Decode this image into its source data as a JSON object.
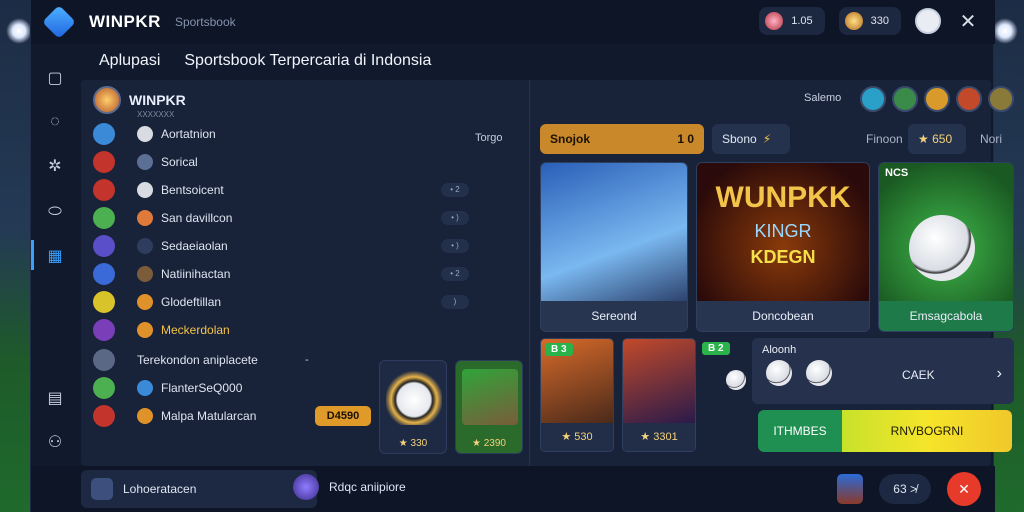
{
  "topbar": {
    "brand": "WINPKR",
    "section": "Sportsbook",
    "pill1_value": "1.05",
    "pill2_value": "330",
    "close_label": "✕"
  },
  "subbar": {
    "left": "Aplupasi",
    "right": "Sportsbook Terpercaria di Indonsia"
  },
  "club": {
    "name": "WINPKR",
    "tag": "XXXXXXX"
  },
  "list": {
    "header": "Torgo",
    "rows": [
      {
        "label": "Aortatnion",
        "dots": ""
      },
      {
        "label": "Sorical",
        "dots": ""
      },
      {
        "label": "Bentsoicent",
        "dots": "• 2"
      },
      {
        "label": "San davillcon",
        "dots": "• )"
      },
      {
        "label": "Sedaeiaolan",
        "dots": "• )"
      },
      {
        "label": "Natiinihactan",
        "dots": "• 2"
      },
      {
        "label": "Glodeftillan",
        "dots": ")"
      },
      {
        "label": "Meckerdolan",
        "dots": ""
      },
      {
        "label": "Terekondon aniplacete",
        "dots": "-"
      },
      {
        "label": "FlanterSeQ000",
        "dots": ""
      },
      {
        "label": "Malpa Matularcan",
        "dots": ""
      }
    ],
    "price_pill": "D4590",
    "mini_cards": [
      {
        "price": "★ 330"
      },
      {
        "price": "★ 2390"
      }
    ]
  },
  "right": {
    "header_label": "Salemo",
    "tabs": {
      "active": "Snojok",
      "active_count": "1 0",
      "b": "Sbono",
      "c": "Finoon",
      "d": "★ 650",
      "e": "Nori"
    },
    "games": [
      {
        "caption": "Sereond"
      },
      {
        "caption": "Doncobean",
        "title": "WUNPKK",
        "title2": "KINGR",
        "title3": "KDEGN"
      },
      {
        "caption": "Emsagcabola",
        "badge": "NCS"
      }
    ],
    "small_games": [
      {
        "price": "★ 530",
        "badge": "B 3"
      },
      {
        "price": "★ 3301"
      }
    ],
    "badge_b": "B 2",
    "info": {
      "title": "Aloonh",
      "cta": "CAEK",
      "chevron": "›"
    },
    "progress": {
      "left": "ITHMBES",
      "right": "RNVBOGRNI"
    }
  },
  "bottombar": {
    "item1": "Lohoeratacen",
    "item1_chevron": "›",
    "item2": "Rdqc aniipiore",
    "count": "63 ≯",
    "fab": "✕"
  }
}
